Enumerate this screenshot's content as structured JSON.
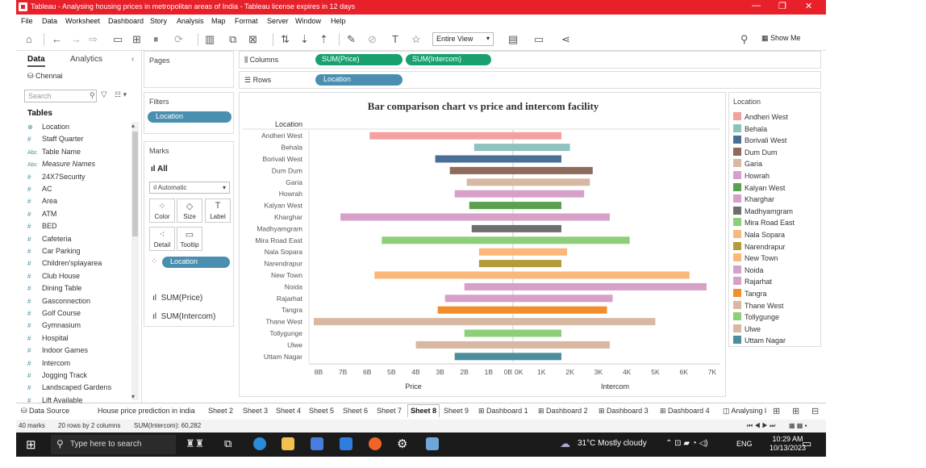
{
  "window": {
    "title": "Tableau - Analysing housing prices in metropolitan areas of India - Tableau license expires in 12 days"
  },
  "menu": [
    "File",
    "Data",
    "Worksheet",
    "Dashboard",
    "Story",
    "Analysis",
    "Map",
    "Format",
    "Server",
    "Window",
    "Help"
  ],
  "toolbar": {
    "fit": "Entire View",
    "show_me": "Show Me"
  },
  "data_pane": {
    "tab_data": "Data",
    "tab_analytics": "Analytics",
    "datasource": "Chennai",
    "search_placeholder": "Search",
    "tables_header": "Tables",
    "fields": [
      {
        "icon": "⊕",
        "name": "Location"
      },
      {
        "icon": "#",
        "name": "Staff Quarter"
      },
      {
        "icon": "Abc",
        "name": "Table Name"
      },
      {
        "icon": "Abc",
        "name": "Measure Names"
      },
      {
        "icon": "#",
        "name": "24X7Security"
      },
      {
        "icon": "#",
        "name": "AC"
      },
      {
        "icon": "#",
        "name": "Area"
      },
      {
        "icon": "#",
        "name": "ATM"
      },
      {
        "icon": "#",
        "name": "BED"
      },
      {
        "icon": "#",
        "name": "Cafeteria"
      },
      {
        "icon": "#",
        "name": "Car Parking"
      },
      {
        "icon": "#",
        "name": "Children'splayarea"
      },
      {
        "icon": "#",
        "name": "Club House"
      },
      {
        "icon": "#",
        "name": "Dining Table"
      },
      {
        "icon": "#",
        "name": "Gasconnection"
      },
      {
        "icon": "#",
        "name": "Golf Course"
      },
      {
        "icon": "#",
        "name": "Gymnasium"
      },
      {
        "icon": "#",
        "name": "Hospital"
      },
      {
        "icon": "#",
        "name": "Indoor Games"
      },
      {
        "icon": "#",
        "name": "Intercom"
      },
      {
        "icon": "#",
        "name": "Jogging Track"
      },
      {
        "icon": "#",
        "name": "Landscaped Gardens"
      },
      {
        "icon": "#",
        "name": "Lift Available"
      }
    ]
  },
  "cards": {
    "pages": "Pages",
    "filters": "Filters",
    "filter_pill": "Location",
    "marks": "Marks",
    "marks_all": "All",
    "mark_type": "Automatic",
    "mark_buttons": [
      "Color",
      "Size",
      "Label",
      "Detail",
      "Tooltip"
    ],
    "color_pill": "Location",
    "sum_price": "SUM(Price)",
    "sum_intercom": "SUM(Intercom)"
  },
  "shelves": {
    "columns_label": "Columns",
    "rows_label": "Rows",
    "col_pill_1": "SUM(Price)",
    "col_pill_2": "SUM(Intercom)",
    "row_pill": "Location"
  },
  "chart_data": {
    "type": "bar",
    "title": "Bar comparison chart vs price and intercom facility",
    "row_header": "Location",
    "categories": [
      "Andheri West",
      "Behala",
      "Borivali West",
      "Dum Dum",
      "Garia",
      "Howrah",
      "Kalyan West",
      "Kharghar",
      "Madhyamgram",
      "Mira Road East",
      "Nala Sopara",
      "Narendrapur",
      "New Town",
      "Noida",
      "Rajarhat",
      "Tangra",
      "Thane West",
      "Tollygunge",
      "Ulwe",
      "Uttam Nagar"
    ],
    "colors": [
      "#f4a0a0",
      "#8fc1bd",
      "#4a6f96",
      "#8e6b5c",
      "#d8b8a2",
      "#d6a0c8",
      "#59a14f",
      "#d6a0c8",
      "#6e6e6e",
      "#8ccf78",
      "#fbb77a",
      "#b39b3a",
      "#fbb77a",
      "#d6a0c8",
      "#d6a0c8",
      "#f28e2b",
      "#d8b8a2",
      "#8ccf78",
      "#d8b8a2",
      "#4a8f9e"
    ],
    "panes": [
      {
        "xlabel": "Price",
        "reversed": true,
        "ticks": [
          "8B",
          "7B",
          "6B",
          "5B",
          "4B",
          "3B",
          "2B",
          "1B",
          "0B"
        ],
        "values": [
          5.9,
          1.6,
          3.2,
          2.6,
          1.9,
          2.4,
          1.8,
          7.1,
          1.7,
          5.4,
          1.4,
          1.4,
          5.7,
          2.0,
          2.8,
          3.1,
          8.2,
          2.0,
          4.0,
          2.4
        ]
      },
      {
        "xlabel": "Intercom",
        "reversed": false,
        "ticks": [
          "0K",
          "1K",
          "2K",
          "3K",
          "4K",
          "5K",
          "6K",
          "7K"
        ],
        "values": [
          1.7,
          2.0,
          1.7,
          2.8,
          2.7,
          2.5,
          1.7,
          3.4,
          1.7,
          4.1,
          1.9,
          1.7,
          6.2,
          6.8,
          3.5,
          3.3,
          5.0,
          1.7,
          3.4,
          1.7
        ]
      }
    ]
  },
  "legend": {
    "title": "Location",
    "items": [
      {
        "label": "Andheri West",
        "color": "#f4a0a0"
      },
      {
        "label": "Behala",
        "color": "#8fc1bd"
      },
      {
        "label": "Borivali West",
        "color": "#4a6f96"
      },
      {
        "label": "Dum Dum",
        "color": "#8e6b5c"
      },
      {
        "label": "Garia",
        "color": "#d8b8a2"
      },
      {
        "label": "Howrah",
        "color": "#d6a0c8"
      },
      {
        "label": "Kalyan West",
        "color": "#59a14f"
      },
      {
        "label": "Kharghar",
        "color": "#d6a0c8"
      },
      {
        "label": "Madhyamgram",
        "color": "#6e6e6e"
      },
      {
        "label": "Mira Road East",
        "color": "#8ccf78"
      },
      {
        "label": "Nala Sopara",
        "color": "#fbb77a"
      },
      {
        "label": "Narendrapur",
        "color": "#b39b3a"
      },
      {
        "label": "New Town",
        "color": "#fbb77a"
      },
      {
        "label": "Noida",
        "color": "#d6a0c8"
      },
      {
        "label": "Rajarhat",
        "color": "#d6a0c8"
      },
      {
        "label": "Tangra",
        "color": "#f28e2b"
      },
      {
        "label": "Thane West",
        "color": "#d8b8a2"
      },
      {
        "label": "Tollygunge",
        "color": "#8ccf78"
      },
      {
        "label": "Ulwe",
        "color": "#d8b8a2"
      },
      {
        "label": "Uttam Nagar",
        "color": "#4a8f9e"
      }
    ]
  },
  "sheet_tabs": [
    "Data Source",
    "House price prediction in india",
    "Sheet 2",
    "Sheet 3",
    "Sheet 4",
    "Sheet 5",
    "Sheet 6",
    "Sheet 7",
    "Sheet 8",
    "Sheet 9",
    "Dashboard 1",
    "Dashboard 2",
    "Dashboard 3",
    "Dashboard 4",
    "Analysing l"
  ],
  "active_tab": "Sheet 8",
  "status": {
    "marks": "40 marks",
    "rows": "20 rows by 2 columns",
    "sum": "SUM(Intercom): 60,282"
  },
  "taskbar": {
    "search": "Type here to search",
    "weather": "31°C  Mostly cloudy",
    "lang": "ENG",
    "time": "10:29 AM",
    "date": "10/13/2023"
  }
}
